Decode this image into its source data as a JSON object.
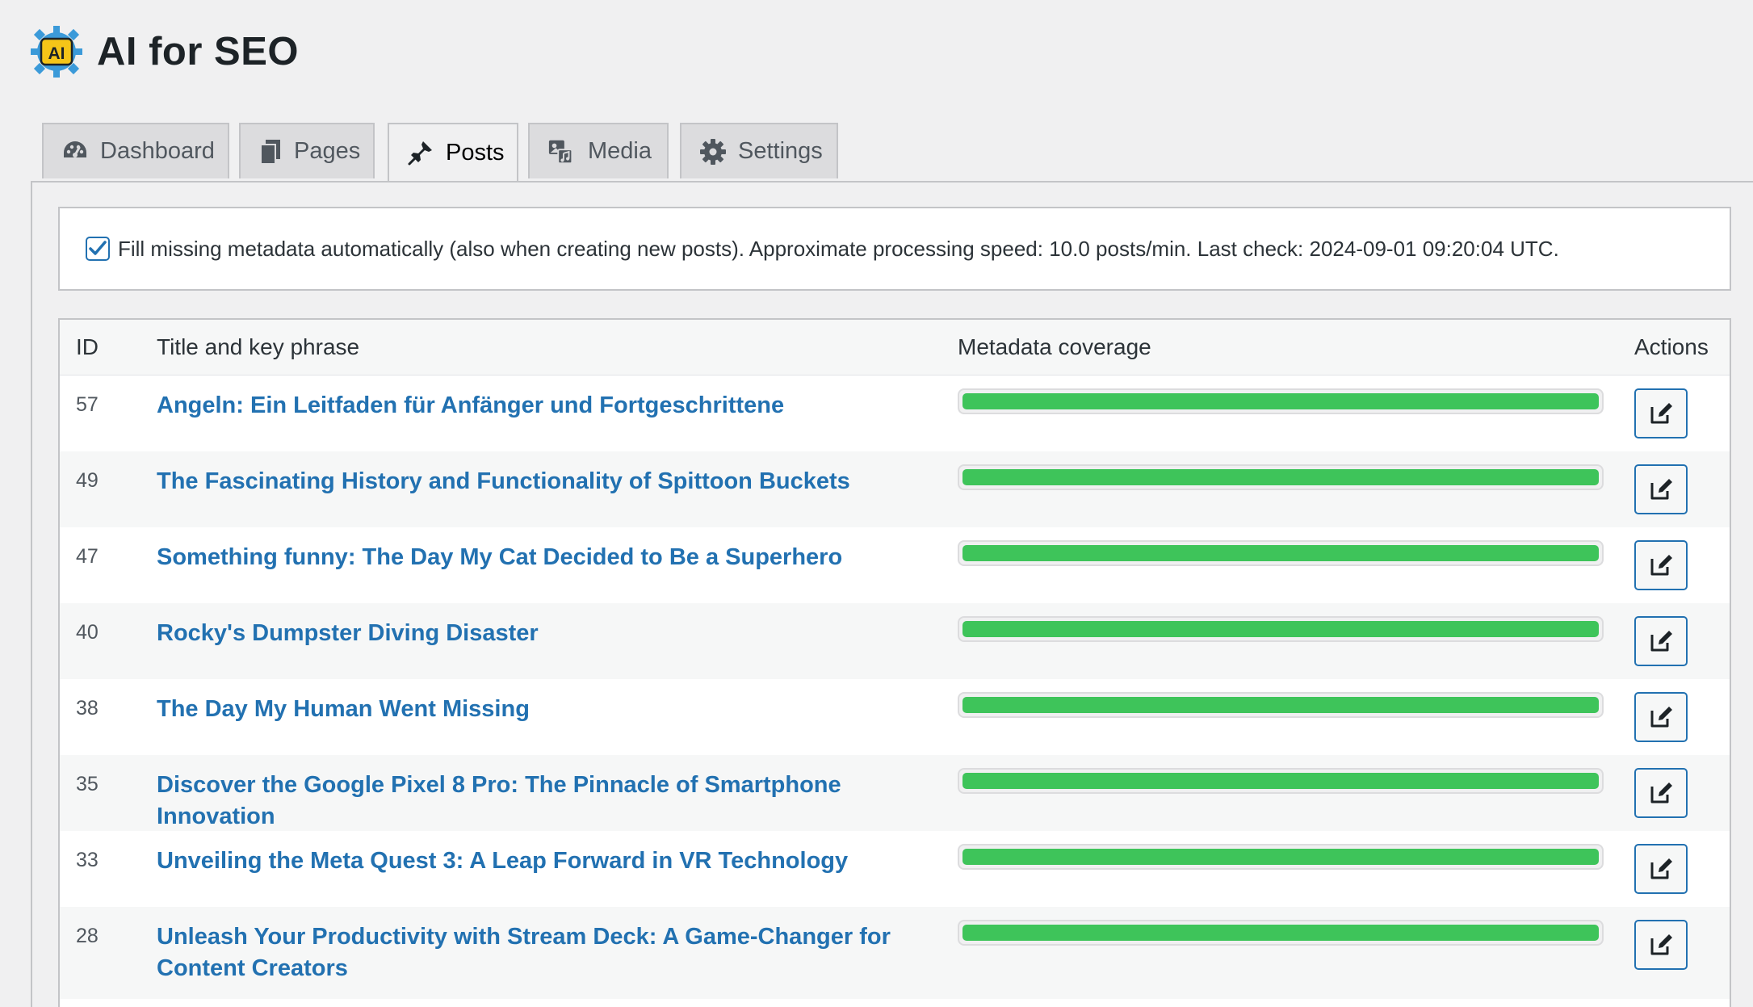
{
  "header": {
    "title": "AI for SEO",
    "logo_text": "AI",
    "logo_icon": "ai-seo-logo",
    "logo_colors": {
      "gear": "#3b9ad9",
      "badge": "#f5c518",
      "text": "#1d2327"
    }
  },
  "tabs": [
    {
      "label": "Dashboard",
      "icon": "dashboard-icon",
      "active": false
    },
    {
      "label": "Pages",
      "icon": "pages-icon",
      "active": false
    },
    {
      "label": "Posts",
      "icon": "pin-icon",
      "active": true
    },
    {
      "label": "Media",
      "icon": "media-icon",
      "active": false
    },
    {
      "label": "Settings",
      "icon": "gear-icon",
      "active": false
    }
  ],
  "notice": {
    "checked": true,
    "text": "Fill missing metadata automatically (also when creating new posts). Approximate processing speed: 10.0 posts/min. Last check: 2024-09-01 09:20:04 UTC."
  },
  "table": {
    "headers": {
      "id": "ID",
      "title": "Title and key phrase",
      "coverage": "Metadata coverage",
      "actions": "Actions"
    },
    "rows": [
      {
        "id": "57",
        "title": "Angeln: Ein Leitfaden für Anfänger und Fortgeschrittene",
        "coverage": 100
      },
      {
        "id": "49",
        "title": "The Fascinating History and Functionality of Spittoon Buckets",
        "coverage": 100
      },
      {
        "id": "47",
        "title": "Something funny: The Day My Cat Decided to Be a Superhero",
        "coverage": 100
      },
      {
        "id": "40",
        "title": "Rocky's Dumpster Diving Disaster",
        "coverage": 100
      },
      {
        "id": "38",
        "title": "The Day My Human Went Missing",
        "coverage": 100
      },
      {
        "id": "35",
        "title": "Discover the Google Pixel 8 Pro: The Pinnacle of Smartphone Innovation",
        "coverage": 100
      },
      {
        "id": "33",
        "title": "Unveiling the Meta Quest 3: A Leap Forward in VR Technology",
        "coverage": 100
      },
      {
        "id": "28",
        "title": "Unleash Your Productivity with Stream Deck: A Game-Changer for Content Creators",
        "coverage": 100
      }
    ],
    "colors": {
      "link": "#2271b1",
      "progress_fill": "#3ec45a",
      "alt_row": "#f6f7f7"
    }
  }
}
